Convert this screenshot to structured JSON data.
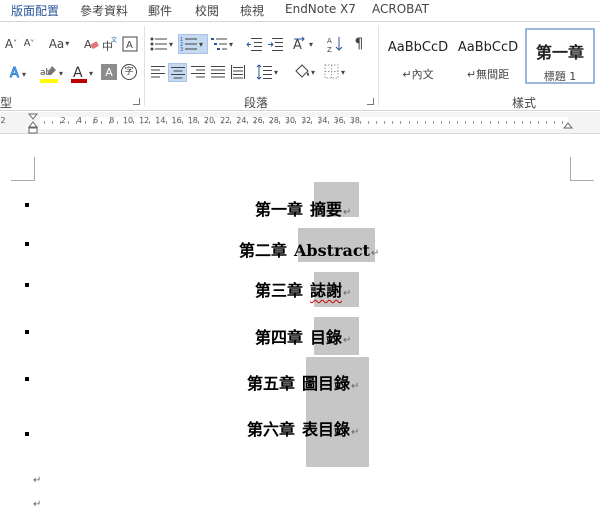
{
  "ribbon_tabs": [
    {
      "label": "版面配置",
      "active": true
    },
    {
      "label": "參考資料",
      "active": false
    },
    {
      "label": "郵件",
      "active": false
    },
    {
      "label": "校閱",
      "active": false
    },
    {
      "label": "檢視",
      "active": false
    },
    {
      "label": "EndNote X7",
      "active": false
    },
    {
      "label": "ACROBAT",
      "active": false
    }
  ],
  "font_group": {
    "label": "型",
    "grow_font_icon": "A^",
    "shrink_font_icon": "A",
    "change_case_icon": "Aa",
    "phonetic_icon": "中",
    "enclose_icon": "A",
    "text_effects_icon": "A",
    "highlight_label": "ab",
    "font_color_label": "A",
    "char_shading_label": "A",
    "enclose_char_label": "字",
    "highlight_color": "#ffff00",
    "font_color": "#c00000"
  },
  "paragraph_group": {
    "label": "段落"
  },
  "styles_group": {
    "label": "樣式",
    "items": [
      {
        "preview": "AaBbCcD",
        "name": "↵內文",
        "selected": false
      },
      {
        "preview": "AaBbCcD",
        "name": "↵無間距",
        "selected": false
      },
      {
        "preview": "第一章",
        "name": "標題 1",
        "selected": true
      }
    ]
  },
  "ruler": {
    "numbers": [
      "2",
      "2",
      "4",
      "6",
      "8",
      "10",
      "12",
      "14",
      "16",
      "18",
      "20",
      "22",
      "24",
      "26",
      "28",
      "30",
      "32",
      "34",
      "36",
      "38"
    ]
  },
  "document": {
    "paragraph_mark": "↵",
    "toc": [
      {
        "chapter": "第一章",
        "title": "摘要"
      },
      {
        "chapter": "第二章",
        "title": "Abstract"
      },
      {
        "chapter": "第三章",
        "title": "誌謝"
      },
      {
        "chapter": "第四章",
        "title": "目錄"
      },
      {
        "chapter": "第五章",
        "title": "圖目錄"
      },
      {
        "chapter": "第六章",
        "title": "表目錄"
      }
    ]
  }
}
